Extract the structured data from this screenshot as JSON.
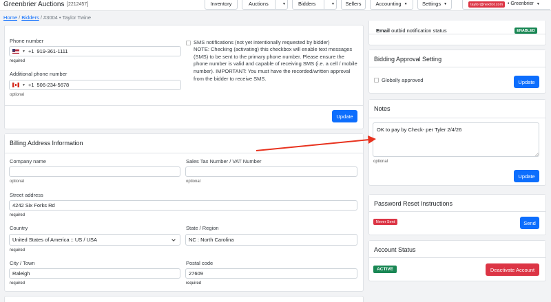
{
  "topnav": {
    "brand": "Greenbrier Auctions",
    "auction_id": "[2212457]",
    "items": {
      "inventory": "Inventory",
      "auctions": "Auctions",
      "bidders": "Bidders",
      "sellers": "Sellers",
      "accounting": "Accounting",
      "settings": "Settings"
    },
    "user_email": "taylor@nextlot.com",
    "org": "Greenbrier"
  },
  "breadcrumb": {
    "home": "Home",
    "bidders": "Bidders",
    "current": "#3004 • Taylor Twine"
  },
  "phone_card": {
    "phone_label": "Phone number",
    "phone_country_code": "+1",
    "phone_value": "919-361-1111",
    "phone_hint": "required",
    "additional_label": "Additional phone number",
    "additional_country_code": "+1",
    "additional_value": "506-234-5678",
    "additional_hint": "optional",
    "sms_title": "SMS notifications (not yet intentionally requested by bidder)",
    "sms_note": "NOTE: Checking (activating) this checkbox will enable text messages (SMS) to be sent to the primary phone number. Please ensure the phone number is valid and capable of receiving SMS (i.e. a cell / mobile number). IMPORTANT: You must have the recorded/written approval from the bidder to receive SMS.",
    "update": "Update"
  },
  "billing": {
    "title": "Billing Address Information",
    "company_label": "Company name",
    "company_value": "",
    "company_hint": "optional",
    "tax_label": "Sales Tax Number / VAT Number",
    "tax_value": "",
    "tax_hint": "optional",
    "street_label": "Street address",
    "street_value": "4242 Six Forks Rd",
    "street_hint": "required",
    "country_label": "Country",
    "country_value": "United States of America :: US / USA",
    "country_hint": "required",
    "state_label": "State / Region",
    "state_value": "NC : North Carolina",
    "city_label": "City / Town",
    "city_value": "Raleigh",
    "city_hint": "required",
    "postal_label": "Postal code",
    "postal_value": "27609",
    "postal_hint": "required"
  },
  "outbid": {
    "label_bold": "Email",
    "label_rest": " outbid notification status",
    "badge": "ENABLED",
    "badge_color": "#198754"
  },
  "bidding_approval": {
    "title": "Bidding Approval Setting",
    "checkbox_label": "Globally approved",
    "update": "Update"
  },
  "notes": {
    "title": "Notes",
    "value": "OK to pay by Check- per Tyler 2/4/26",
    "hint": "optional",
    "update": "Update"
  },
  "password_reset": {
    "title": "Password Reset Instructions",
    "badge": "Never Sent",
    "badge_color": "#dc3545",
    "send": "Send"
  },
  "account_status": {
    "title": "Account Status",
    "badge": "ACTIVE",
    "badge_color": "#198754",
    "deactivate": "Deactivate Account"
  },
  "colors": {
    "primary": "#0d6efd",
    "danger": "#dc3545",
    "success": "#198754",
    "annotation_arrow": "#e8321e"
  }
}
